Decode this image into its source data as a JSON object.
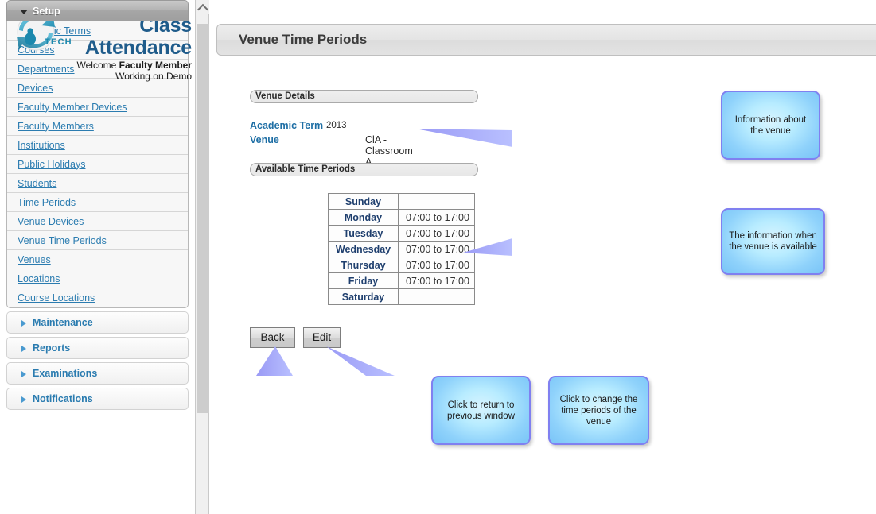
{
  "brand": {
    "logo_icon": "globe-swirl-logo",
    "logo_text": "TECH",
    "title_line1": "Class",
    "title_line2": "Attendance",
    "welcome_prefix": "Welcome ",
    "welcome_user": "Faculty Member",
    "working_on": "Working on Demo"
  },
  "sidebar": {
    "setup": {
      "label": "Setup",
      "expanded": true,
      "items": [
        {
          "label": "Academic Terms"
        },
        {
          "label": "Courses"
        },
        {
          "label": "Departments"
        },
        {
          "label": "Devices"
        },
        {
          "label": "Faculty Member Devices"
        },
        {
          "label": "Faculty Members"
        },
        {
          "label": "Institutions"
        },
        {
          "label": "Public Holidays"
        },
        {
          "label": "Students"
        },
        {
          "label": "Time Periods"
        },
        {
          "label": "Venue Devices"
        },
        {
          "label": "Venue Time Periods"
        },
        {
          "label": "Venues"
        },
        {
          "label": "Locations"
        },
        {
          "label": "Course Locations"
        }
      ]
    },
    "collapsed_sections": [
      {
        "label": "Maintenance"
      },
      {
        "label": "Reports"
      },
      {
        "label": "Examinations"
      },
      {
        "label": "Notifications"
      }
    ]
  },
  "page": {
    "title": "Venue Time Periods"
  },
  "venue_details": {
    "section_label": "Venue Details",
    "rows": [
      {
        "label": "Academic Term",
        "value": "2013"
      },
      {
        "label": "Venue",
        "value": "ClA - Classroom A"
      }
    ]
  },
  "available_time_periods": {
    "section_label": "Available Time Periods",
    "rows": [
      {
        "day": "Sunday",
        "time": ""
      },
      {
        "day": "Monday",
        "time": "07:00 to 17:00"
      },
      {
        "day": "Tuesday",
        "time": "07:00 to 17:00"
      },
      {
        "day": "Wednesday",
        "time": "07:00 to 17:00"
      },
      {
        "day": "Thursday",
        "time": "07:00 to 17:00"
      },
      {
        "day": "Friday",
        "time": "07:00 to 17:00"
      },
      {
        "day": "Saturday",
        "time": ""
      }
    ]
  },
  "buttons": {
    "back": "Back",
    "edit": "Edit"
  },
  "callouts": {
    "venue": "Information about the venue",
    "available": "The information when the venue is available",
    "back": "Click to return to previous window",
    "edit": "Click to change the time periods of the venue"
  },
  "colors": {
    "brand_blue": "#1f5c8b",
    "link_blue": "#2b7cb0",
    "callout_border": "#8080f0",
    "callout_fill": "#b8ecff",
    "table_day_text": "#1f3f6e"
  },
  "scrollbar": {
    "up_icon": "chevron-up-icon"
  }
}
